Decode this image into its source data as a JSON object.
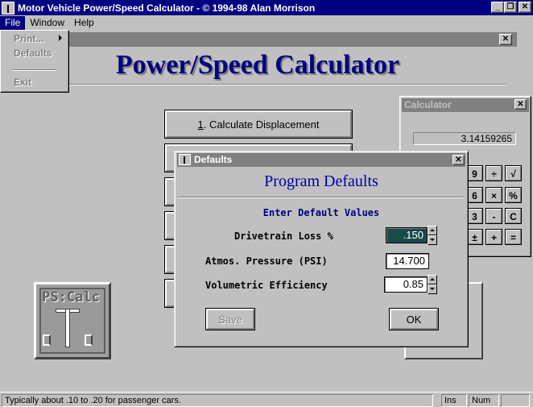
{
  "app": {
    "title": "Motor Vehicle Power/Speed Calculator - © 1994-98 Alan Morrison",
    "title_buttons": {
      "minimize": "_",
      "restore": "❐",
      "close": "✕"
    }
  },
  "menubar": {
    "items": [
      "File",
      "Window",
      "Help"
    ]
  },
  "file_menu": {
    "items": [
      "Print...",
      "Defaults",
      "Exit"
    ]
  },
  "main": {
    "title": "Power/Speed Calculator",
    "close_glyph": "✕",
    "buttons": [
      {
        "number": "1",
        "label": ". Calculate Displacement"
      }
    ],
    "logo_text": "PS:Calc"
  },
  "calculator": {
    "title": "Calculator",
    "close_glyph": "✕",
    "display": "3.14159265",
    "keys": [
      "9",
      "÷",
      "√",
      "6",
      "×",
      "%",
      "3",
      "-",
      "C",
      "±",
      "+",
      "="
    ]
  },
  "dialog": {
    "title": "Defaults",
    "close_glyph": "✕",
    "heading": "Program Defaults",
    "subheading": "Enter Default Values",
    "fields": [
      {
        "label": "Drivetrain Loss %",
        "value": ".150"
      },
      {
        "label": "Atmos. Pressure (PSI)",
        "value": "14.700"
      },
      {
        "label": "Volumetric Efficiency",
        "value": "0.85"
      }
    ],
    "save_label": "Save",
    "ok_label": "OK"
  },
  "statusbar": {
    "message": "Typically about .10 to .20 for passenger cars.",
    "ins": "Ins",
    "num": "Num"
  },
  "colors": {
    "title_active": "#000080",
    "title_inactive": "#808080",
    "face": "#c0c0c0",
    "heading": "#000080"
  }
}
